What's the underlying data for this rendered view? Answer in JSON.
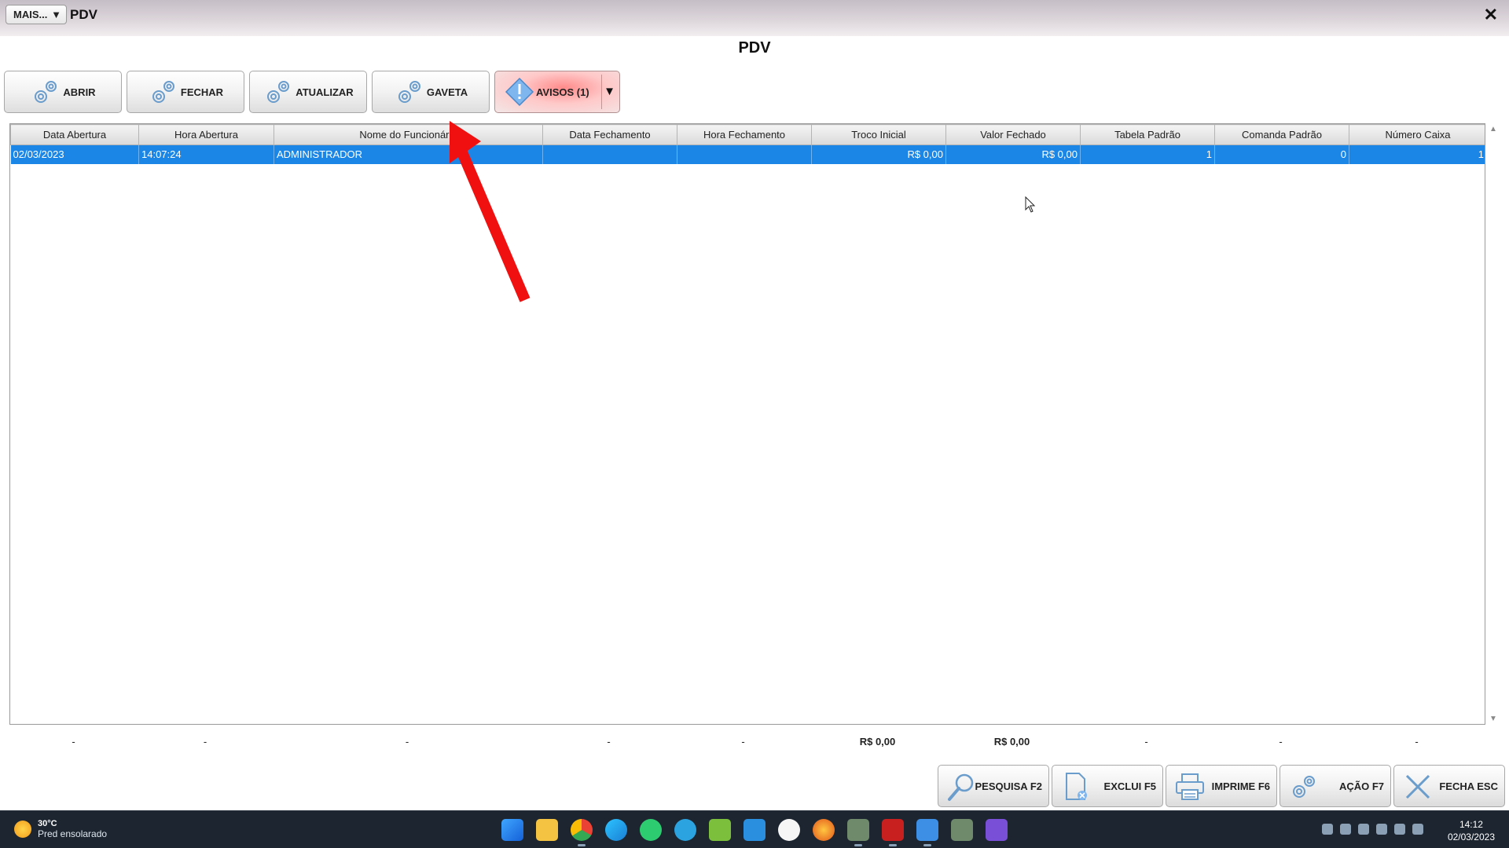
{
  "window": {
    "menu_label": "MAIS...",
    "title": "PDV",
    "close_symbol": "✕"
  },
  "page": {
    "title": "PDV"
  },
  "toolbar": {
    "abrir": "ABRIR",
    "fechar": "FECHAR",
    "atualizar": "ATUALIZAR",
    "gaveta": "GAVETA",
    "avisos": "AVISOS (1)"
  },
  "grid": {
    "columns": [
      "Data Abertura",
      "Hora Abertura",
      "Nome do Funcionário",
      "Data Fechamento",
      "Hora Fechamento",
      "Troco Inicial",
      "Valor Fechado",
      "Tabela Padrão",
      "Comanda Padrão",
      "Número Caixa"
    ],
    "rows": [
      [
        "02/03/2023",
        "14:07:24",
        "ADMINISTRADOR",
        "",
        "",
        "R$ 0,00",
        "R$ 0,00",
        "1",
        "0",
        "1"
      ]
    ]
  },
  "totals": [
    "-",
    "-",
    "-",
    "-",
    "-",
    "R$ 0,00",
    "R$ 0,00",
    "-",
    "-",
    "-"
  ],
  "actions": {
    "pesquisa": "PESQUISA F2",
    "exclui": "EXCLUI F5",
    "imprime": "IMPRIME F6",
    "acao": "AÇÃO F7",
    "fecha": "FECHA ESC"
  },
  "taskbar": {
    "weather_temp": "30°C",
    "weather_desc": "Pred ensolarado",
    "time": "14:12",
    "date": "02/03/2023",
    "icons": [
      "windows-start-icon",
      "file-explorer-icon",
      "chrome-icon",
      "edge-icon",
      "whatsapp-icon",
      "telegram-icon",
      "sheet-app-icon",
      "remote-app-icon",
      "shield-app-icon",
      "firefox-icon",
      "erp-app-icon",
      "filezilla-icon",
      "notepad-icon",
      "erp-app-2-icon",
      "clapper-app-icon"
    ]
  },
  "colors": {
    "selection": "#1b86e6",
    "arrow": "#f01010",
    "avisos_bg": "#ff8a8a"
  }
}
